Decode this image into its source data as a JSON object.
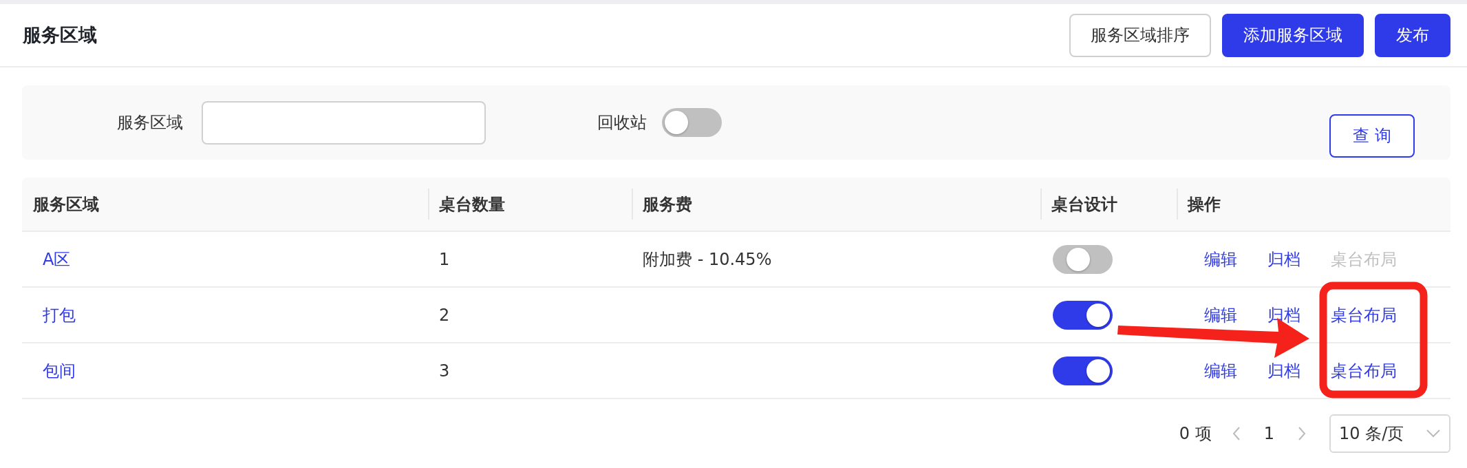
{
  "page": {
    "title": "服务区域"
  },
  "toolbar": [
    {
      "label": "服务区域排序",
      "kind": "outline"
    },
    {
      "label": "添加服务区域",
      "kind": "primary"
    },
    {
      "label": "发布",
      "kind": "primary"
    }
  ],
  "filter": {
    "field_label": "服务区域",
    "recycle_label": "回收站",
    "recycle_on": false,
    "query_button": "查 询"
  },
  "table": {
    "columns": [
      "服务区域",
      "桌台数量",
      "服务费",
      "桌台设计",
      "操作"
    ],
    "rows": [
      {
        "area": "A区",
        "count": "1",
        "fee": "附加费 - 10.45%",
        "design_on": false,
        "actions": [
          {
            "label": "编辑",
            "disabled": false
          },
          {
            "label": "归档",
            "disabled": false
          },
          {
            "label": "桌台布局",
            "disabled": true
          }
        ]
      },
      {
        "area": "打包",
        "count": "2",
        "design_on": true,
        "actions": [
          {
            "label": "编辑",
            "disabled": false
          },
          {
            "label": "归档",
            "disabled": false
          },
          {
            "label": "桌台布局",
            "disabled": false
          }
        ]
      },
      {
        "area": "包间",
        "count": "3",
        "design_on": true,
        "actions": [
          {
            "label": "编辑",
            "disabled": false
          },
          {
            "label": "归档",
            "disabled": false
          },
          {
            "label": "桌台布局",
            "disabled": false
          }
        ]
      }
    ]
  },
  "pagination": {
    "total": "0 项",
    "page": "1",
    "page_size": "10 条/页"
  }
}
